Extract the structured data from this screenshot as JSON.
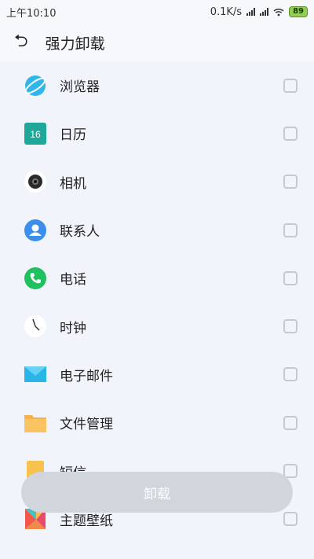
{
  "status": {
    "time": "上午10:10",
    "speed": "0.1K/s",
    "battery": "89"
  },
  "header": {
    "title": "强力卸载"
  },
  "apps": [
    {
      "label": "浏览器",
      "icon": "browser-icon"
    },
    {
      "label": "日历",
      "icon": "calendar-icon",
      "date": "16"
    },
    {
      "label": "相机",
      "icon": "camera-icon"
    },
    {
      "label": "联系人",
      "icon": "contacts-icon"
    },
    {
      "label": "电话",
      "icon": "phone-icon"
    },
    {
      "label": "时钟",
      "icon": "clock-icon"
    },
    {
      "label": "电子邮件",
      "icon": "email-icon"
    },
    {
      "label": "文件管理",
      "icon": "folder-icon"
    },
    {
      "label": "短信",
      "icon": "sms-icon"
    },
    {
      "label": "主题壁纸",
      "icon": "themes-icon"
    }
  ],
  "actions": {
    "uninstall_label": "卸载"
  }
}
